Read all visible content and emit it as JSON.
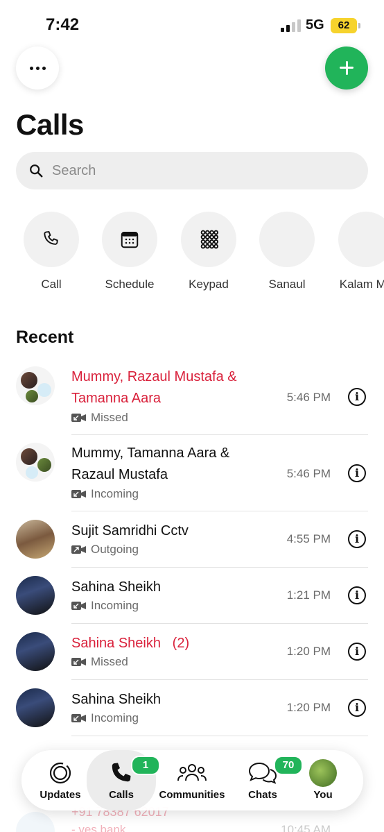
{
  "status_bar": {
    "time": "7:42",
    "network": "5G",
    "battery": "62"
  },
  "header": {
    "title": "Calls"
  },
  "search": {
    "placeholder": "Search"
  },
  "quick_actions": [
    {
      "label": "Call",
      "icon": "phone-icon"
    },
    {
      "label": "Schedule",
      "icon": "calendar-icon"
    },
    {
      "label": "Keypad",
      "icon": "keypad-icon"
    },
    {
      "label": "Sanaul",
      "icon": "contact-photo"
    },
    {
      "label": "Kalam Mu",
      "icon": "contact-photo"
    }
  ],
  "recent": {
    "title": "Recent",
    "calls": [
      {
        "name": "Mummy, Razaul Mustafa & Tamanna Aara",
        "type": "Missed",
        "time": "5:46 PM",
        "missed": true,
        "direction": "incoming"
      },
      {
        "name": "Mummy, Tamanna Aara & Razaul Mustafa",
        "type": "Incoming",
        "time": "5:46 PM",
        "missed": false,
        "direction": "incoming"
      },
      {
        "name": "Sujit Samridhi Cctv",
        "type": "Outgoing",
        "time": "4:55 PM",
        "missed": false,
        "direction": "outgoing"
      },
      {
        "name": "Sahina Sheikh",
        "type": "Incoming",
        "time": "1:21 PM",
        "missed": false,
        "direction": "incoming"
      },
      {
        "name": "Sahina Sheikh   (2)",
        "type": "Missed",
        "time": "1:20 PM",
        "missed": true,
        "direction": "incoming"
      },
      {
        "name": "Sahina Sheikh",
        "type": "Incoming",
        "time": "1:20 PM",
        "missed": false,
        "direction": "incoming"
      }
    ],
    "partial_row": {
      "number": "+91 78387 62017",
      "subtitle": "- yes bank",
      "time": "10:45 AM"
    }
  },
  "tabbar": {
    "tabs": [
      {
        "label": "Updates",
        "icon": "updates-icon"
      },
      {
        "label": "Calls",
        "icon": "phone-icon",
        "badge": "1",
        "active": true
      },
      {
        "label": "Communities",
        "icon": "communities-icon"
      },
      {
        "label": "Chats",
        "icon": "chats-icon",
        "badge": "70"
      },
      {
        "label": "You",
        "icon": "profile-avatar"
      }
    ]
  },
  "colors": {
    "accent_green": "#21b45a",
    "missed_red": "#d9213b",
    "battery_yellow": "#f6d32d"
  }
}
